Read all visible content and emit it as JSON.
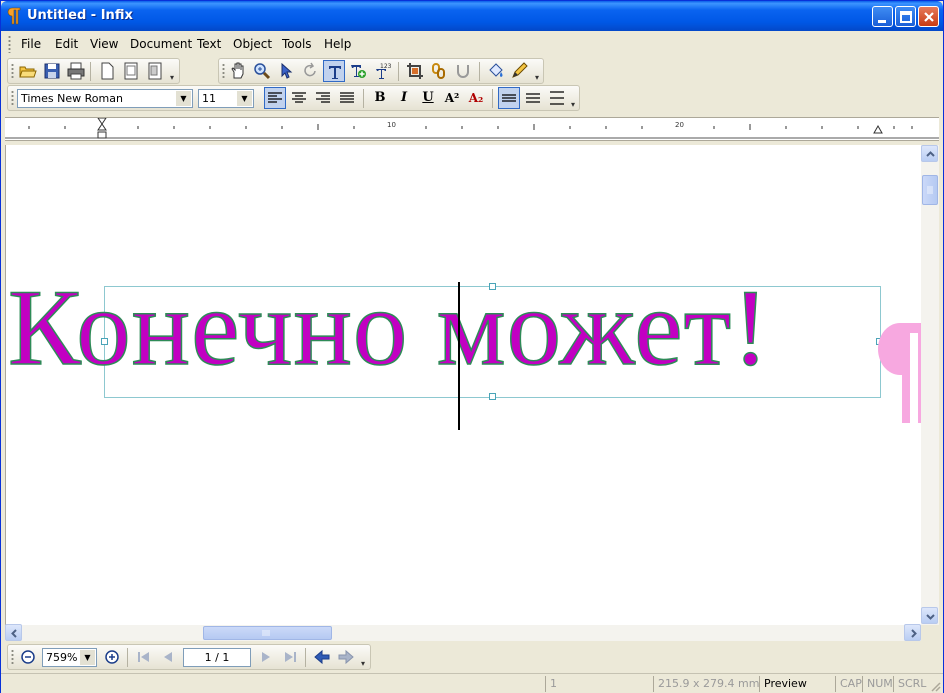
{
  "window": {
    "title": "Untitled - Infix"
  },
  "menu": {
    "items": [
      "File",
      "Edit",
      "View",
      "Document",
      "Text",
      "Object",
      "Tools",
      "Help"
    ]
  },
  "format_toolbar": {
    "font_name": "Times New Roman",
    "font_size": "11",
    "bold_label": "B",
    "italic_label": "I",
    "underline_label": "U",
    "superscript_label": "A²",
    "subscript_label": "A₂"
  },
  "ruler": {
    "labels": [
      "10",
      "20"
    ]
  },
  "document": {
    "text": "Конечно может!",
    "text_color": "#c200c2",
    "outline_color": "#2e8b57",
    "pilcrow_color": "#f7a8e0"
  },
  "navigation": {
    "zoom": "759%",
    "page": "1 / 1"
  },
  "statusbar": {
    "message": "",
    "page_number": "1",
    "page_size": "215.9 x 279.4 mm",
    "mode": "Preview",
    "caps": "CAP",
    "num": "NUM",
    "scroll": "SCRL"
  },
  "colors": {
    "titlebar": "#0058e6",
    "chrome": "#ece9d8",
    "selection": "#c1d2ee"
  }
}
